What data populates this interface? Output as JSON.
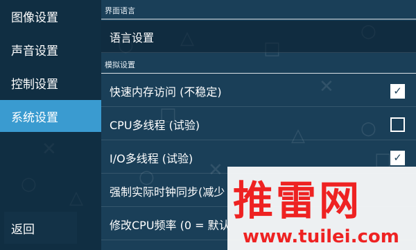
{
  "sidebar": {
    "items": [
      {
        "label": "图像设置"
      },
      {
        "label": "声音设置"
      },
      {
        "label": "控制设置"
      },
      {
        "label": "系统设置"
      }
    ],
    "back_label": "返回"
  },
  "main": {
    "section_language": "界面语言",
    "language_row": "语言设置",
    "section_emulation": "模拟设置",
    "rows": [
      {
        "label": "快速内存访问 (不稳定)",
        "checked": true
      },
      {
        "label": "CPU多线程 (试验)",
        "checked": false
      },
      {
        "label": "I/O多线程 (试验)",
        "checked": true
      },
      {
        "label": "强制实际时钟同步(减少"
      },
      {
        "label": "修改CPU频率 (0 = 默认"
      }
    ]
  },
  "watermark": {
    "title": "推雷网",
    "url": "www.tuilei.com"
  },
  "colors": {
    "background": "#1a3f58",
    "active_tab": "#3a9bd0",
    "watermark_red": "#ee2222"
  }
}
